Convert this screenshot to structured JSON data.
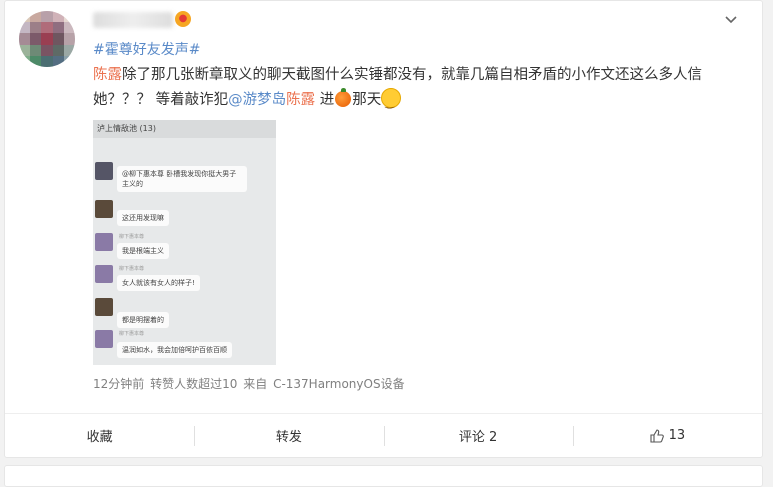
{
  "post": {
    "topic": "#霍尊好友发声#",
    "text_part1": "陈露",
    "text_part2": "除了那几张断章取义的聊天截图什么实锤都没有，就靠几篇自相矛盾的小作文还这么多人信她？？？ 等着敲诈犯",
    "mention_1": "@游梦岛",
    "mention_2": "陈露",
    "text_part3": " 进",
    "text_part4": "那天",
    "meta": {
      "time": "12分钟前",
      "reposts": "转赞人数超过10",
      "source_prefix": "来自",
      "source": "C-137HarmonyOS设备"
    }
  },
  "screenshot": {
    "header": "泸上情敌池 (13)",
    "messages": [
      {
        "name": "",
        "text": "@柳下惠本尊 卧槽我发现你挺大男子主义的"
      },
      {
        "name": "",
        "text": "这还用发现嘛"
      },
      {
        "name": "柳下惠本尊",
        "text": "我是根端主义"
      },
      {
        "name": "柳下惠本尊",
        "text": "女人就该有女人的样子!"
      },
      {
        "name": "",
        "text": "都是明摆着的"
      },
      {
        "name": "柳下惠本尊",
        "text": "温润如水，我会加倍呵护百依百顺"
      }
    ]
  },
  "actions": {
    "favorite": "收藏",
    "repost": "转发",
    "comment": "评论 2",
    "like": "13"
  },
  "icons": {
    "chevron": "chevron-down-icon",
    "like": "thumbs-up-icon"
  },
  "colors": {
    "topic": "#5a8ac8",
    "mention": "#eb7350",
    "meta": "#808080"
  }
}
